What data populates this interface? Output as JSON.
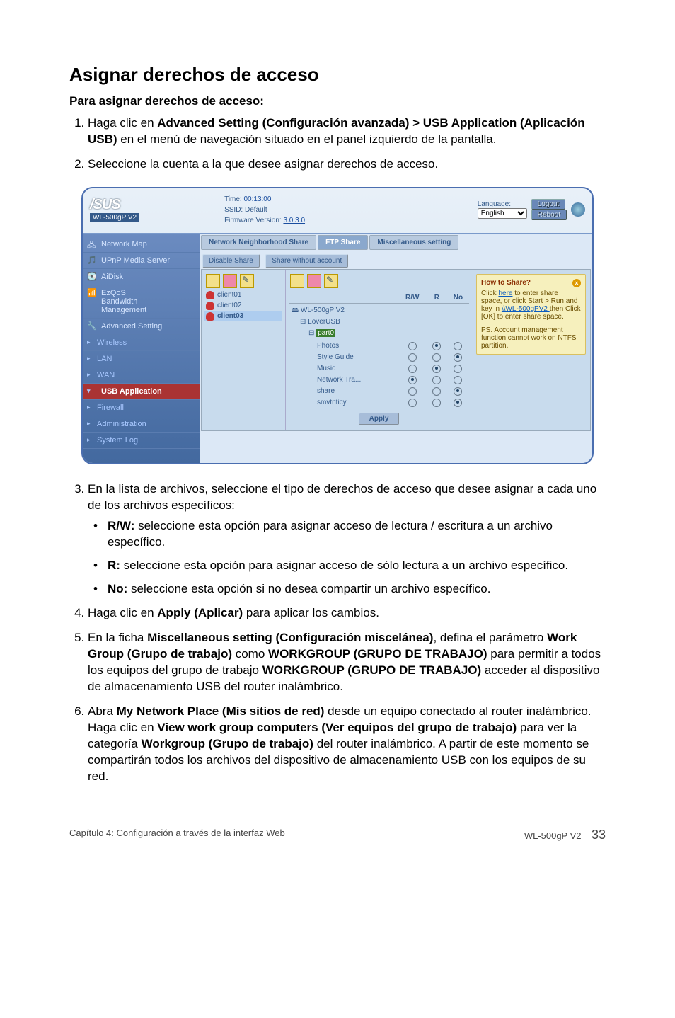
{
  "heading": "Asignar derechos de acceso",
  "subheading": "Para asignar derechos de acceso:",
  "step1_a": "Haga clic en ",
  "step1_b": "Advanced Setting (Configuración avanzada) > USB Application (Aplicación USB)",
  "step1_c": " en el menú de navegación situado en el panel izquierdo de la pantalla.",
  "step2": "Seleccione la cuenta a la que desee asignar derechos de acceso.",
  "shot": {
    "model": "WL-500gP V2",
    "time_label": "Time: ",
    "time_value": "00:13:00",
    "ssid_label": "SSID: Default",
    "fw_label": "Firmware Version: ",
    "fw_value": "3.0.3.0",
    "lang_label": "Language:",
    "lang_value": "English",
    "btn_logout": "Logout",
    "btn_reboot": "Reboot",
    "sidebar": {
      "s1": "Network Map",
      "s2": "UPnP Media Server",
      "s3": "AiDisk",
      "s4a": "EzQoS",
      "s4b": "Bandwidth",
      "s4c": "Management",
      "s5": "Advanced Setting",
      "s6": "Wireless",
      "s7": "LAN",
      "s8": "WAN",
      "s9": "USB Application",
      "s10": "Firewall",
      "s11": "Administration",
      "s12": "System Log"
    },
    "tabs": {
      "t1": "Network Neighborhood Share",
      "t2": "FTP Share",
      "t3": "Miscellaneous setting"
    },
    "btns": {
      "disable": "Disable Share",
      "nowo": "Share without account"
    },
    "users": {
      "u1": "client01",
      "u2": "client02",
      "u3": "client03"
    },
    "tree": {
      "root": "WL-500gP V2",
      "n1": "LoverUSB",
      "n2": "part0",
      "f1": "Photos",
      "f2": "Style Guide",
      "f3": "Music",
      "f4": "Network Tra...",
      "f5": "share",
      "f6": "smvtnticy"
    },
    "cols": {
      "c1": "R/W",
      "c2": "R",
      "c3": "No"
    },
    "apply": "Apply",
    "hint": {
      "title": "How to Share?",
      "l1a": "Click ",
      "l1b": "here",
      "l1c": " to enter share space, or click Start > Run and key in ",
      "l1d": "\\\\WL-500gPV2 ",
      "l1e": " then Click [OK] to enter share space.",
      "l2": "PS. Account management function cannot work on NTFS partition."
    }
  },
  "step3_a": "En la lista de archivos, seleccione el tipo de derechos de acceso que desee asignar a cada uno de los archivos específicos:",
  "b1a": "R/W:",
  "b1b": " seleccione esta opción para asignar acceso de lectura / escritura a un archivo específico.",
  "b2a": "R:",
  "b2b": " seleccione esta opción para asignar acceso de sólo lectura a un archivo específico.",
  "b3a": "No:",
  "b3b": " seleccione esta opción si no desea compartir un archivo específico.",
  "step4_a": "Haga clic en ",
  "step4_b": "Apply (Aplicar)",
  "step4_c": " para aplicar los cambios.",
  "step5_a": "En la ficha ",
  "step5_b": "Miscellaneous setting (Configuración miscelánea)",
  "step5_c": ", defina el parámetro ",
  "step5_d": "Work Group (Grupo de trabajo)",
  "step5_e": " como ",
  "step5_f": "WORKGROUP (GRUPO DE TRABAJO)",
  "step5_g": " para permitir a todos los equipos del grupo de trabajo ",
  "step5_h": "WORKGROUP (GRUPO DE TRABAJO)",
  "step5_i": " acceder al dispositivo de almacenamiento USB del router inalámbrico.",
  "step6_a": "Abra ",
  "step6_b": "My Network Place (Mis sitios de red)",
  "step6_c": " desde un equipo conectado al router inalámbrico. Haga clic en ",
  "step6_d": "View work group computers (Ver equipos del grupo de trabajo)",
  "step6_e": " para ver la categoría ",
  "step6_f": "Workgroup (Grupo de trabajo)",
  "step6_g": " del router inalámbrico. A partir de este momento se compartirán todos los archivos del dispositivo de almacenamiento USB con los equipos de su red.",
  "footer": {
    "left": "Capítulo 4: Configuración a través de la interfaz Web",
    "mid": "WL-500gP V2",
    "page": "33"
  }
}
